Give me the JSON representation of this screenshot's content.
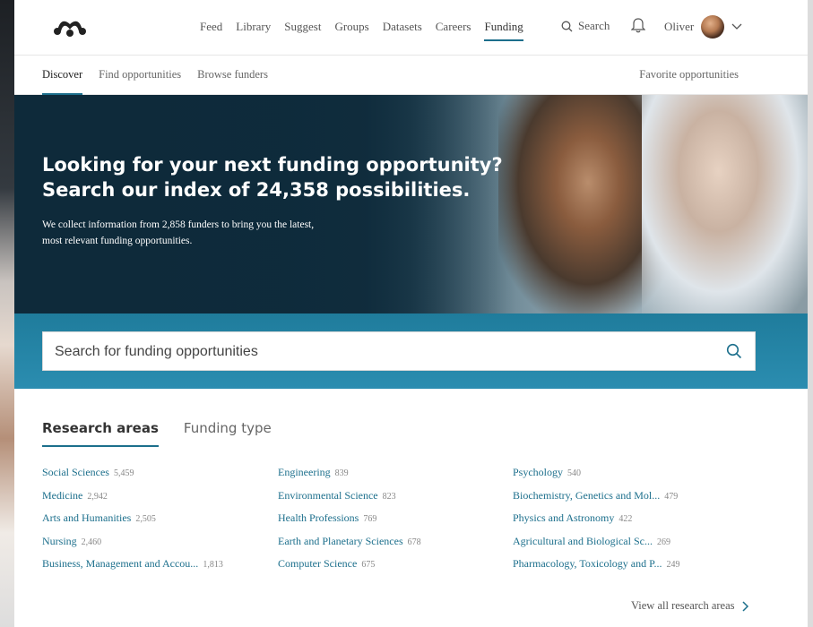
{
  "nav": {
    "links": [
      "Feed",
      "Library",
      "Suggest",
      "Groups",
      "Datasets",
      "Careers",
      "Funding"
    ],
    "active": "Funding",
    "search_label": "Search",
    "user_name": "Oliver"
  },
  "subnav": {
    "tabs": [
      "Discover",
      "Find opportunities",
      "Browse funders"
    ],
    "active": "Discover",
    "favorites_label": "Favorite opportunities"
  },
  "hero": {
    "title_line1": "Looking for your next funding opportunity?",
    "title_line2": "Search our index of 24,358 possibilities.",
    "subtitle_line1": "We collect information from 2,858 funders to bring you the latest,",
    "subtitle_line2": "most relevant funding opportunities."
  },
  "search": {
    "placeholder": "Search for funding opportunities"
  },
  "research": {
    "tab_areas": "Research areas",
    "tab_funding_type": "Funding type",
    "columns": [
      [
        {
          "label": "Social Sciences",
          "count": "5,459"
        },
        {
          "label": "Medicine",
          "count": "2,942"
        },
        {
          "label": "Arts and Humanities",
          "count": "2,505"
        },
        {
          "label": "Nursing",
          "count": "2,460"
        },
        {
          "label": "Business, Management and Accou...",
          "count": "1,813"
        }
      ],
      [
        {
          "label": "Engineering",
          "count": "839"
        },
        {
          "label": "Environmental Science",
          "count": "823"
        },
        {
          "label": "Health Professions",
          "count": "769"
        },
        {
          "label": "Earth and Planetary Sciences",
          "count": "678"
        },
        {
          "label": "Computer Science",
          "count": "675"
        }
      ],
      [
        {
          "label": "Psychology",
          "count": "540"
        },
        {
          "label": "Biochemistry, Genetics and Mol...",
          "count": "479"
        },
        {
          "label": "Physics and Astronomy",
          "count": "422"
        },
        {
          "label": "Agricultural and Biological Sc...",
          "count": "269"
        },
        {
          "label": "Pharmacology, Toxicology and P...",
          "count": "249"
        }
      ]
    ],
    "view_all_label": "View all research areas"
  },
  "colors": {
    "accent": "#1c6f8c",
    "hero_dark": "#0f2d3d",
    "band": "#2b8db0"
  }
}
